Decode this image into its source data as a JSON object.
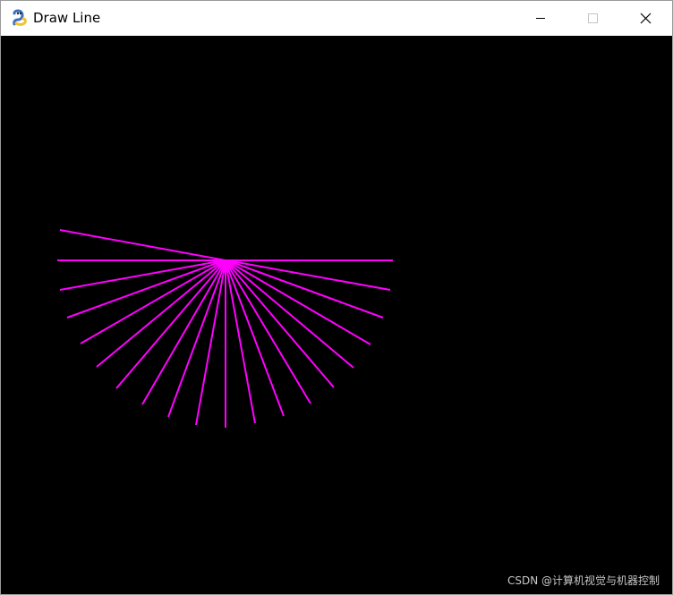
{
  "window": {
    "title": "Draw Line",
    "app_icon": "pygame-snake-icon",
    "controls": {
      "minimize": "minimize-icon",
      "maximize": "maximize-icon",
      "close": "close-icon"
    }
  },
  "canvas": {
    "background": "#000000",
    "line_color": "#ff00ff"
  },
  "watermark": "CSDN @计算机视觉与机器控制"
}
